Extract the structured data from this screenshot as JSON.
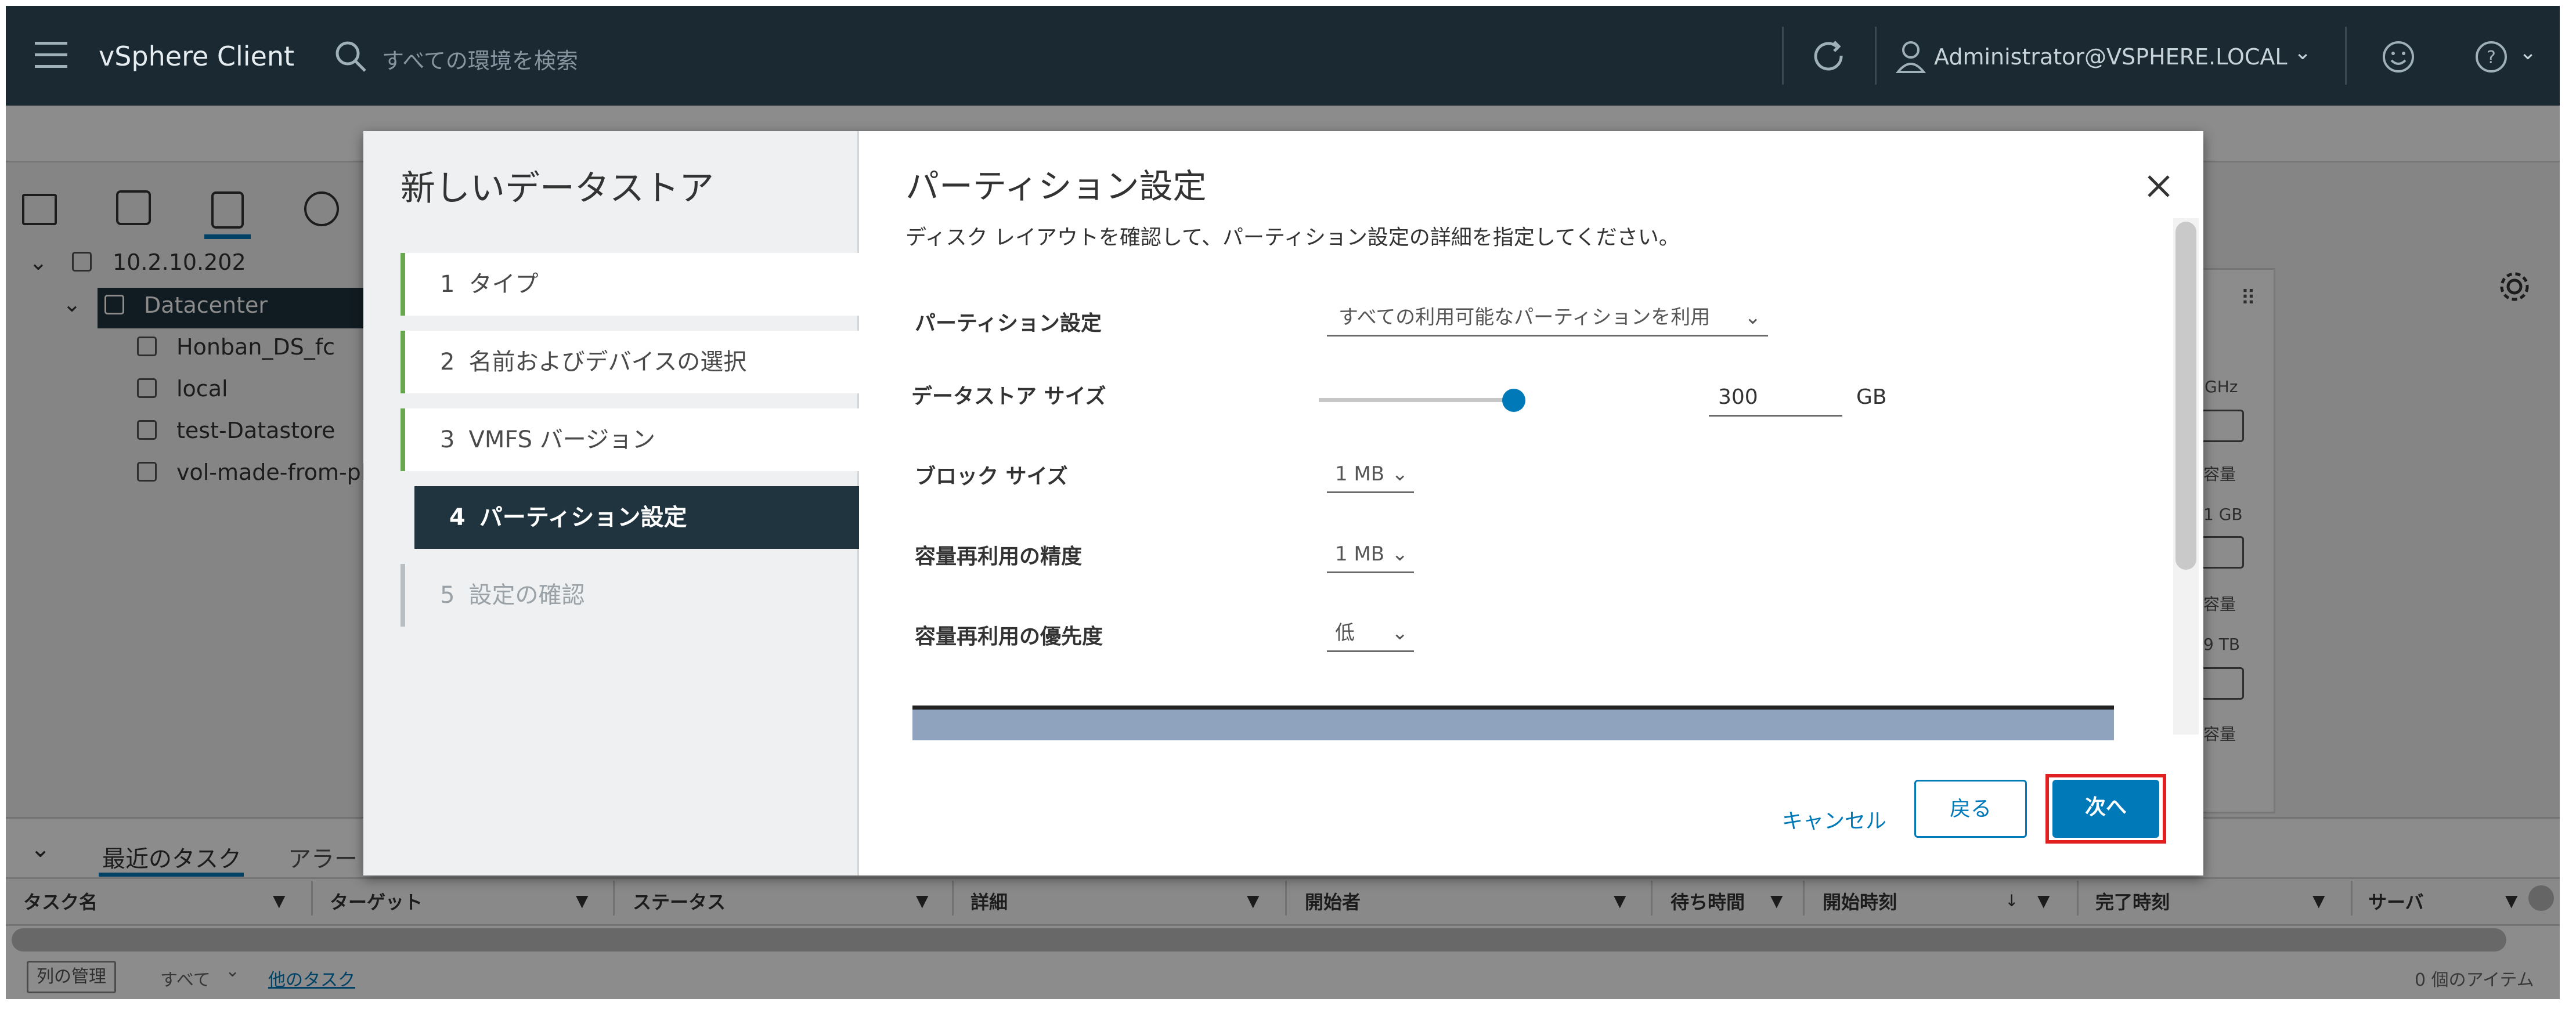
{
  "header": {
    "app_title": "vSphere Client",
    "search_placeholder": "すべての環境を検索",
    "user": "Administrator@VSPHERE.LOCAL"
  },
  "tree": {
    "host": "10.2.10.202",
    "datacenter": "Datacenter",
    "datastores": [
      "Honban_DS_fc",
      "local",
      "test-Datastore",
      "vol-made-from-pl"
    ]
  },
  "side_panel": {
    "ghz_label": "GHz",
    "capacity_label": "容量",
    "gb_label": "1 GB",
    "tb_label": "9 TB"
  },
  "dialog": {
    "wizard_title": "新しいデータストア",
    "steps": [
      {
        "num": "1",
        "label": "タイプ"
      },
      {
        "num": "2",
        "label": "名前およびデバイスの選択"
      },
      {
        "num": "3",
        "label": "VMFS バージョン"
      },
      {
        "num": "4",
        "label": "パーティション設定"
      },
      {
        "num": "5",
        "label": "設定の確認"
      }
    ],
    "page_title": "パーティション設定",
    "page_subtitle": "ディスク レイアウトを確認して、パーティション設定の詳細を指定してください。",
    "fields": {
      "partition_label": "パーティション設定",
      "partition_value": "すべての利用可能なパーティションを利用",
      "size_label": "データストア サイズ",
      "size_value": "300",
      "size_unit": "GB",
      "size_slider_fraction": 1.0,
      "block_label": "ブロック サイズ",
      "block_value": "1 MB",
      "reclaim_gran_label": "容量再利用の精度",
      "reclaim_gran_value": "1 MB",
      "reclaim_prio_label": "容量再利用の優先度",
      "reclaim_prio_value": "低"
    },
    "buttons": {
      "cancel": "キャンセル",
      "back": "戻る",
      "next": "次へ"
    }
  },
  "tasks": {
    "tab_recent": "最近のタスク",
    "tab_alarms": "アラー",
    "columns": [
      "タスク名",
      "ターゲット",
      "ステータス",
      "詳細",
      "開始者",
      "待ち時間",
      "開始時刻",
      "完了時刻",
      "サーバ"
    ],
    "manage_columns": "列の管理",
    "filter_all": "すべて",
    "more_tasks": "他のタスク",
    "item_count": "0 個のアイテム"
  },
  "colors": {
    "header_bg": "#1b2a32",
    "primary": "#0079b8",
    "step_active_bg": "#20343f",
    "step_done_border": "#6aa84f",
    "highlight": "#e02020"
  }
}
